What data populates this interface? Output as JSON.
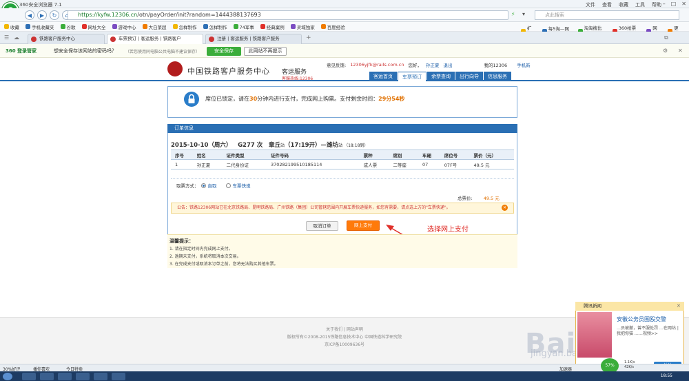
{
  "browser": {
    "title": "360安全浏览器 7.1",
    "menu": [
      "文件",
      "查看",
      "收藏",
      "工具",
      "帮助"
    ],
    "url_host": "https://kyfw.12306.cn",
    "url_path": "/otn/payOrder/init?random=1444388137693",
    "search_placeholder": "点此搜索",
    "bookmarks": [
      "收藏",
      "手机收藏夹",
      "谷歌",
      "网址大全",
      "游戏中心",
      "大白菜超",
      "怎样制作",
      "怎样制作",
      "74军事",
      "经典案例",
      "灵域独家",
      "百度经验"
    ],
    "bookmarks_right": [
      "扩展",
      "每5淘—网5",
      "淘淘搜比价",
      "360抢票王",
      "网银",
      "更多"
    ],
    "tabs": [
      "铁路客户服务中心",
      "车票预订 | 客运服务 | 铁路客户",
      "注册 | 客运服务 | 铁路客户服务"
    ]
  },
  "pwbar": {
    "brand": "360 登录管家",
    "question": "想安全保存该网站的密码吗？",
    "hint": "（若您使用同电脑公共电脑不建议保存）",
    "save_label": "安全保存",
    "never_label": "此网站不再提示"
  },
  "site": {
    "name": "中国铁路客户服务中心",
    "service": "客运服务",
    "hotline": "客服热线:12306",
    "feedback_label": "意见反馈:",
    "feedback_email": "12306yjfk@rails.com.cn",
    "greeting": "您好，",
    "user": "孙正夏",
    "logout": "退出",
    "my12306": "我的12306",
    "mobile": "手机新",
    "nav": [
      "客运首页",
      "车票预订",
      "余票查询",
      "出行向导",
      "信息服务"
    ]
  },
  "lock": {
    "text_a": "席位已锁定，请在",
    "minutes": "30",
    "text_b": "分钟内进行支付，完成网上购票。支付剩余时间：",
    "remaining": "29分54秒"
  },
  "order": {
    "header": "订单信息",
    "date": "2015-10-10（周六）",
    "train": "G277 次",
    "from": "章丘",
    "from_suffix": "站",
    "depart": "（17:19开）—",
    "to": "潍坊",
    "to_suffix": "站",
    "arrive": "（18:18到）",
    "columns": [
      "序号",
      "姓名",
      "证件类型",
      "证件号码",
      "票种",
      "席别",
      "车厢",
      "席位号",
      "票价（元）"
    ],
    "rows": [
      [
        "1",
        "孙正夏",
        "二代身份证",
        "370282199510185114",
        "成人票",
        "二等座",
        "07",
        "07F号",
        "49.5 元"
      ]
    ],
    "fetch_label": "取票方式：",
    "fetch_self": "自取",
    "fetch_express": "车票快递",
    "total_label": "总票价:",
    "total_value": "49.5 元",
    "notice": "公告：铁路12306网站已在北京铁路局、昆明铁路局、广州铁路（集团）公司管辖范围内开展车票快递服务，如您有需要，请点选上方的\"车票快递\"。",
    "cancel_label": "取消订单",
    "pay_label": "网上支付",
    "annotation": "选择网上支付",
    "tips_title": "温馨提示：",
    "tips": [
      "1. 请在指定时间内完成网上支付。",
      "2. 逾期未支付，系统将取消本次交易。",
      "3. 在完成支付或取消本订单之前，您将无法购买其他车票。"
    ]
  },
  "footer": {
    "links": "关于我们 | 网站声明",
    "copyright": "版权所有©2008-2015铁路信息技术中心    中国铁道科学研究院",
    "icp": "京ICP备10009636号"
  },
  "news": {
    "header": "腾讯新闻",
    "title": "安徽公务员围殴交警",
    "body": "…员被撤，曾不服处罚 …在网站 | 我把你猫 ……视频>>",
    "follow": "关注"
  },
  "status": {
    "zoom": "30%好评",
    "mode": "播你喜欢",
    "today": "今日特卖",
    "speed": "57%",
    "net": "加速器",
    "net_up": "1.1K/s",
    "net_down": "42K/s"
  },
  "watermark": {
    "main": "Baidu 经验",
    "sub": "jingyan.baidu.com"
  },
  "clock": "18:55"
}
